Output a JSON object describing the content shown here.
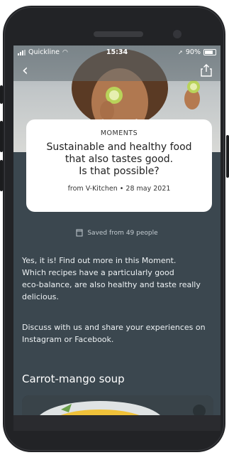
{
  "status_bar": {
    "carrier": "Quickline",
    "time": "15:34",
    "battery": "90%"
  },
  "moment_card": {
    "category": "MOMENTS",
    "title_lines": [
      "Sustainable and healthy food",
      "that also tastes good.",
      "Is that possible?"
    ],
    "from_label": "from",
    "source_and_date": "V-Kitchen • 28 may 2021"
  },
  "saved_label": "Saved from 49 people",
  "description": {
    "paragraph1": [
      "Yes, it is! Find out more in this Moment.",
      "Which recipes have a particularly good",
      "eco-balance, are also healthy and taste really",
      "delicious."
    ],
    "paragraph2": [
      "Discuss with us and share your experiences on",
      "Instagram or Facebook."
    ]
  },
  "section": {
    "title": "Carrot-mango soup"
  },
  "icons": {
    "back": "chevron-left-icon",
    "share": "share-icon",
    "saved": "bookmark-icon",
    "wifi": "wifi-icon",
    "location": "location-arrow-icon"
  },
  "colors": {
    "screen_bg": "#3b474f",
    "card_bg": "#ffffff",
    "phone_body": "#222326"
  }
}
